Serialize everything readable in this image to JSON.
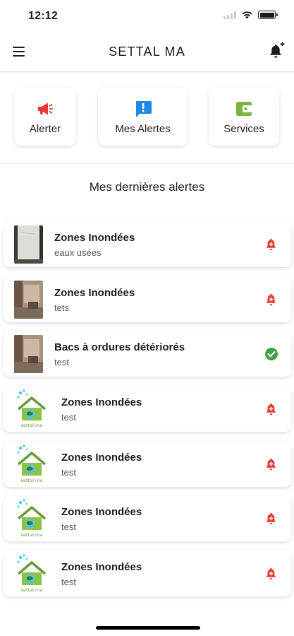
{
  "status_bar": {
    "time": "12:12"
  },
  "header": {
    "title": "SETTAL MA",
    "menu_icon": "hamburger-icon",
    "action_icon": "bell-plus-icon"
  },
  "quick_actions": [
    {
      "label": "Alerter",
      "icon": "megaphone-icon",
      "color": "#e53935"
    },
    {
      "label": "Mes Alertes",
      "icon": "alert-message-icon",
      "color": "#1e88e5"
    },
    {
      "label": "Services",
      "icon": "wallet-icon",
      "color": "#7cb342"
    }
  ],
  "section_title": "Mes dernières alertes",
  "alerts": [
    {
      "title": "Zones Inondées",
      "subtitle": "eaux usées",
      "thumb": "photo",
      "status": "pending"
    },
    {
      "title": "Zones Inondées",
      "subtitle": "tets",
      "thumb": "photo",
      "status": "pending"
    },
    {
      "title": "Bacs à ordures détériorés",
      "subtitle": "test",
      "thumb": "photo",
      "status": "resolved"
    },
    {
      "title": "Zones Inondées",
      "subtitle": "test",
      "thumb": "logo",
      "status": "pending"
    },
    {
      "title": "Zones Inondées",
      "subtitle": "test",
      "thumb": "logo",
      "status": "pending"
    },
    {
      "title": "Zones Inondées",
      "subtitle": "test",
      "thumb": "logo",
      "status": "pending"
    },
    {
      "title": "Zones Inondées",
      "subtitle": "test",
      "thumb": "logo",
      "status": "pending"
    }
  ],
  "logo_text": "settal ma",
  "colors": {
    "pending": "#e53935",
    "resolved": "#43a047",
    "accent_green": "#7cb342"
  }
}
